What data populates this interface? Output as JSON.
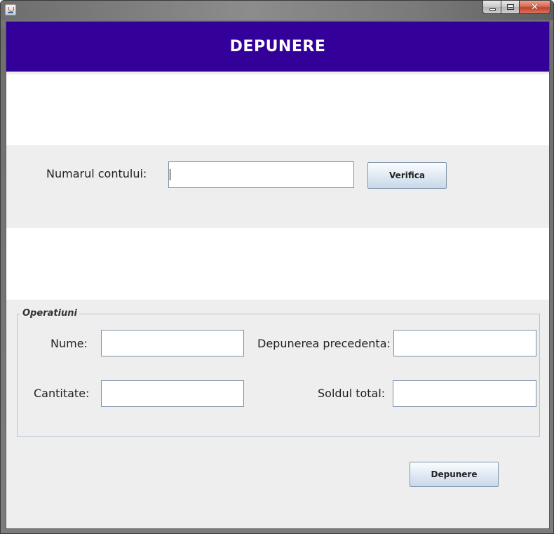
{
  "window": {
    "close_glyph": "✕"
  },
  "header": {
    "title": "DEPUNERE"
  },
  "account": {
    "label": "Numarul contului:",
    "value": "",
    "verify_label": "Verifica"
  },
  "operations": {
    "group_title": "Operatiuni",
    "name_label": "Nume:",
    "name_value": "",
    "quantity_label": "Cantitate:",
    "quantity_value": "",
    "previous_label": "Depunerea precedenta:",
    "previous_value": "",
    "balance_label": "Soldul total:",
    "balance_value": ""
  },
  "actions": {
    "deposit_label": "Depunere"
  },
  "colors": {
    "header_bg": "#330099",
    "panel_bg": "#eeeeee"
  }
}
